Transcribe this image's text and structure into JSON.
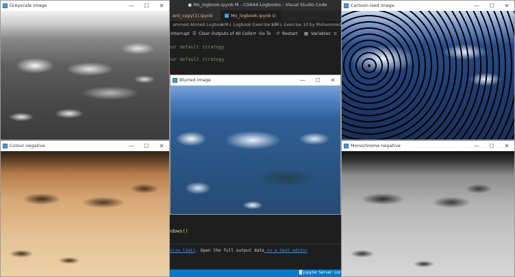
{
  "vscode": {
    "title": "● Mo_logbook.ipynb M - CO644-Logbooks - Visual Studio Code",
    "tabs": [
      {
        "label": "ent_copy(1).ipynb M"
      },
      {
        "label": "Mo_logbook.ipynb U"
      }
    ],
    "breadcrumb": {
      "seg1": "ammed Ahmed Logbook",
      "sep1": ">",
      "seg2": "M↓ Logbook Exercise 10",
      "sep2": ">",
      "seg3": "M↓ Exercise 10 by Mohammed Ahm"
    },
    "toolbar": {
      "interrupt": "Interrupt",
      "clear_outputs": "Clear Outputs of All Cells",
      "goto": "Go To",
      "restart": "Restart",
      "variables": "Variables"
    },
    "code_lines": [
      "our default strategy",
      "our default strategy"
    ],
    "code_call_name": "ndows",
    "code_call_parens": "()",
    "output": {
      "prefix": "size limit",
      "middle": ". Open the full output data",
      "link": " in a text editor"
    },
    "status": {
      "jupyter": "▓ Jupyter Server: Loc"
    }
  },
  "windows": {
    "greyscale": {
      "title": "Greyscale image"
    },
    "cartoon": {
      "title": "Cartoon-ised image"
    },
    "colour_negative": {
      "title": "Colour negative"
    },
    "blurred": {
      "title": "Blurred image"
    },
    "monochrome_negative": {
      "title": "Monochrome negative"
    }
  },
  "window_controls": {
    "minimize": "—",
    "maximize": "☐",
    "close": "✕"
  }
}
